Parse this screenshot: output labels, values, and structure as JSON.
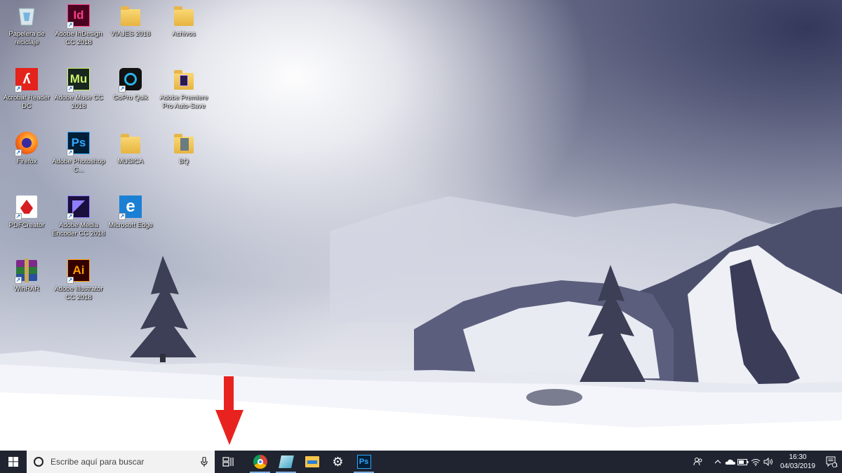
{
  "desktop": {
    "icons": [
      {
        "name": "recycle-bin",
        "label": "Papelera de reciclaje"
      },
      {
        "name": "indesign",
        "label": "Adobe InDesign CC 2018",
        "abbr": "Id"
      },
      {
        "name": "folder-viajes",
        "label": "VIAJES 2018"
      },
      {
        "name": "folder-archivos",
        "label": "Achivos"
      },
      {
        "name": "acrobat",
        "label": "Acrobat Reader DC"
      },
      {
        "name": "muse",
        "label": "Adobe Muse CC 2018",
        "abbr": "Mu"
      },
      {
        "name": "gopro",
        "label": "GoPro Quik"
      },
      {
        "name": "premiere-autosave",
        "label": "Adobe Premiere Pro Auto-Save"
      },
      {
        "name": "firefox",
        "label": "Firefox"
      },
      {
        "name": "photoshop",
        "label": "Adobe Photoshop C...",
        "abbr": "Ps"
      },
      {
        "name": "folder-musica",
        "label": "MUSICA"
      },
      {
        "name": "folder-bq",
        "label": "BQ"
      },
      {
        "name": "pdfcreator",
        "label": "PDFCreator"
      },
      {
        "name": "media-encoder",
        "label": "Adobe Media Encoder CC 2018"
      },
      {
        "name": "edge",
        "label": "Microsoft Edge"
      },
      {
        "name": "winrar",
        "label": "WinRAR"
      },
      {
        "name": "illustrator",
        "label": "Adobe Illustrator CC 2018",
        "abbr": "Ai"
      }
    ]
  },
  "taskbar": {
    "search_placeholder": "Escribe aquí para buscar",
    "ps_label": "Ps",
    "clock_time": "16:30",
    "clock_date": "04/03/2019",
    "notification_count": "1"
  },
  "icons": {
    "start": "windows-logo-icon",
    "search": "cortana-circle-icon",
    "mic": "microphone-icon",
    "task_view": "task-view-icon",
    "chrome": "chrome-icon",
    "folder_app": "file-explorer-icon",
    "settings": "gear-icon",
    "people": "people-icon",
    "arrow": "down-arrow-icon"
  },
  "colors": {
    "taskbar": "#1f2430",
    "accent": "#7fb0e6",
    "arrow": "#e8231f",
    "indesign_fg": "#ff3c8e",
    "indesign_bg": "#49021f",
    "muse_fg": "#c9f26b",
    "muse_bg": "#19261f",
    "photoshop_fg": "#31a8ff",
    "photoshop_bg": "#001e36",
    "illustrator_fg": "#ff9a00",
    "illustrator_bg": "#330000"
  }
}
